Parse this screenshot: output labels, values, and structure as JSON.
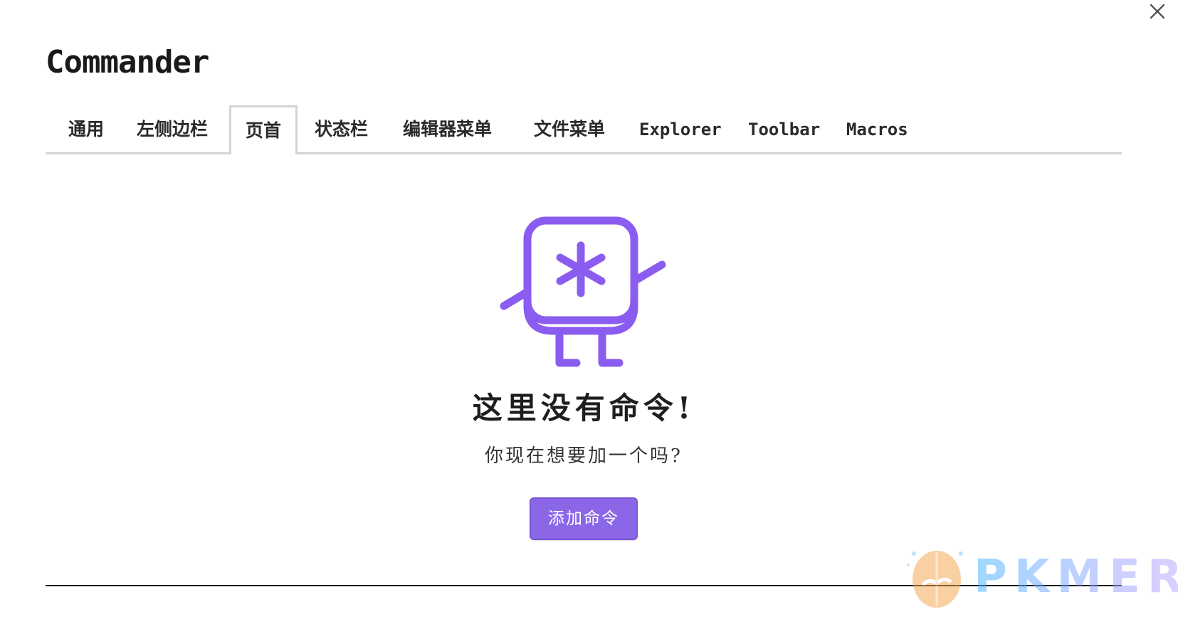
{
  "dialog": {
    "title": "Commander",
    "close_icon": "close-icon"
  },
  "tabs": [
    {
      "label": "通用",
      "active": false
    },
    {
      "label": "左侧边栏",
      "active": false
    },
    {
      "label": "页首",
      "active": true
    },
    {
      "label": "状态栏",
      "active": false
    },
    {
      "label": "编辑器菜单",
      "active": false
    },
    {
      "label": "文件菜单",
      "active": false
    },
    {
      "label": "Explorer",
      "active": false
    },
    {
      "label": "Toolbar",
      "active": false
    },
    {
      "label": "Macros",
      "active": false
    }
  ],
  "empty_state": {
    "icon": "robot-mascot-icon",
    "title": "这里没有命令!",
    "subtitle": "你现在想要加一个吗?",
    "add_button_label": "添加命令"
  },
  "watermark": {
    "text": "PKMER"
  },
  "colors": {
    "accent": "#8b67e8",
    "tab_border": "#d4d4d4",
    "divider": "#1a1a1a"
  }
}
